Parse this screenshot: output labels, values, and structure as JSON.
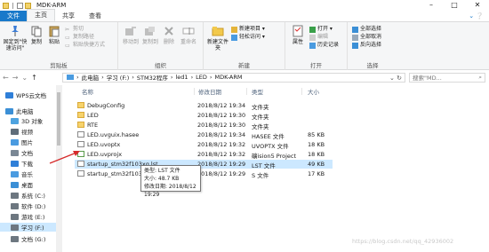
{
  "window": {
    "title": "MDK-ARM"
  },
  "tabs": [
    {
      "label": "文件"
    },
    {
      "label": "主页"
    },
    {
      "label": "共享"
    },
    {
      "label": "查看"
    }
  ],
  "ribbon": {
    "clipboard": {
      "label": "剪贴板",
      "pin": "固定到\"快速访问\"",
      "copy": "复制",
      "paste": "粘贴",
      "copy_path": "复制路径",
      "paste_shortcut": "粘贴快捷方式",
      "cut": "剪切"
    },
    "organize": {
      "label": "组织",
      "move_to": "移动到",
      "copy_to": "复制到",
      "delete": "删除",
      "rename": "重命名"
    },
    "new": {
      "label": "新建",
      "new_folder": "新建文件夹",
      "new_item": "新建项目 ▾",
      "easy_access": "轻松访问 ▾"
    },
    "open": {
      "label": "打开",
      "properties": "属性",
      "open": "打开 ▾",
      "edit": "编辑",
      "history": "历史记录"
    },
    "select": {
      "label": "选择",
      "select_all": "全部选择",
      "select_none": "全部取消",
      "invert": "反向选择"
    }
  },
  "address": {
    "crumbs": [
      "此电脑",
      "学习 (F:)",
      "STM32程序",
      "led1",
      "LED",
      "MDK-ARM"
    ],
    "search_placeholder": "搜索\"MD..."
  },
  "nav": {
    "items": [
      {
        "label": "WPS云文档",
        "color": "#2f7fd8"
      },
      {
        "label": "此电脑",
        "color": "#3b8fd6"
      },
      {
        "label": "3D 对象",
        "color": "#4da3e0"
      },
      {
        "label": "视频",
        "color": "#5f6d7a"
      },
      {
        "label": "图片",
        "color": "#4a9be0"
      },
      {
        "label": "文档",
        "color": "#7a8794"
      },
      {
        "label": "下载",
        "color": "#2f7fd8"
      },
      {
        "label": "音乐",
        "color": "#4a9be0"
      },
      {
        "label": "桌面",
        "color": "#3b8fd6"
      },
      {
        "label": "系统 (C:)",
        "color": "#6d7780"
      },
      {
        "label": "软件 (D:)",
        "color": "#6d7780"
      },
      {
        "label": "游戏 (E:)",
        "color": "#6d7780"
      },
      {
        "label": "学习 (F:)",
        "color": "#6d7780"
      },
      {
        "label": "文档 (G:)",
        "color": "#6d7780"
      }
    ]
  },
  "columns": {
    "name": "名称",
    "date": "修改日期",
    "type": "类型",
    "size": "大小"
  },
  "files": [
    {
      "name": "DebugConfig",
      "date": "2018/8/12 19:34",
      "type": "文件夹",
      "size": "",
      "kind": "folder"
    },
    {
      "name": "LED",
      "date": "2018/8/12 19:30",
      "type": "文件夹",
      "size": "",
      "kind": "folder"
    },
    {
      "name": "RTE",
      "date": "2018/8/12 19:30",
      "type": "文件夹",
      "size": "",
      "kind": "folder"
    },
    {
      "name": "LED.uvguix.hasee",
      "date": "2018/8/12 19:34",
      "type": "HASEE 文件",
      "size": "85 KB",
      "kind": "doc"
    },
    {
      "name": "LED.uvoptx",
      "date": "2018/8/12 19:32",
      "type": "UVOPTX 文件",
      "size": "18 KB",
      "kind": "doc"
    },
    {
      "name": "LED.uvprojx",
      "date": "2018/8/12 19:32",
      "type": "礦ision5 Project",
      "size": "18 KB",
      "kind": "proj"
    },
    {
      "name": "startup_stm32f103xg.lst",
      "date": "2018/8/12 19:29",
      "type": "LST 文件",
      "size": "49 KB",
      "kind": "doc"
    },
    {
      "name": "startup_stm32f103xg.s",
      "date": "2018/8/12 19:29",
      "type": "S 文件",
      "size": "17 KB",
      "kind": "doc"
    }
  ],
  "tooltip": {
    "line1": "类型: LST 文件",
    "line2": "大小: 48.7 KB",
    "line3": "修改日期: 2018/8/12 19:29"
  },
  "watermark": "https://blog.csdn.net/qq_42936002"
}
